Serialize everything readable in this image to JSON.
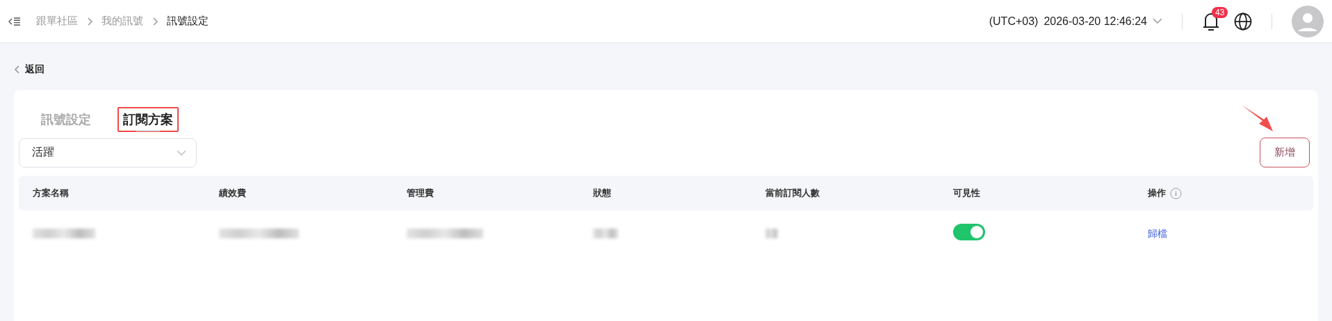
{
  "breadcrumb": [
    {
      "label": "跟單社區",
      "current": false
    },
    {
      "label": "我的訊號",
      "current": false
    },
    {
      "label": "訊號設定",
      "current": true
    }
  ],
  "header": {
    "timezone": "(UTC+03)",
    "datetime": "2026-03-20 12:46:24",
    "notifications": "43"
  },
  "back_link": "返回",
  "tabs": [
    {
      "label": "訊號設定",
      "selected": false,
      "highlighted": false
    },
    {
      "label": "訂閱方案",
      "selected": true,
      "highlighted": true
    }
  ],
  "filter": {
    "value": "活躍"
  },
  "add_button": {
    "label": "新增",
    "pointed_at": true
  },
  "table": {
    "columns": [
      {
        "label": "方案名稱",
        "info": false
      },
      {
        "label": "績效費",
        "info": false
      },
      {
        "label": "管理費",
        "info": false
      },
      {
        "label": "狀態",
        "info": false
      },
      {
        "label": "當前訂閱人數",
        "info": false
      },
      {
        "label": "可見性",
        "info": false
      },
      {
        "label": "操作",
        "info": true
      }
    ],
    "rows": [
      {
        "cells": [
          {
            "kind": "blurred"
          },
          {
            "kind": "blurred"
          },
          {
            "kind": "blurred"
          },
          {
            "kind": "blurred"
          },
          {
            "kind": "blurred"
          },
          {
            "kind": "toggle",
            "on": true
          },
          {
            "kind": "link",
            "text": "歸檔"
          }
        ]
      }
    ]
  }
}
